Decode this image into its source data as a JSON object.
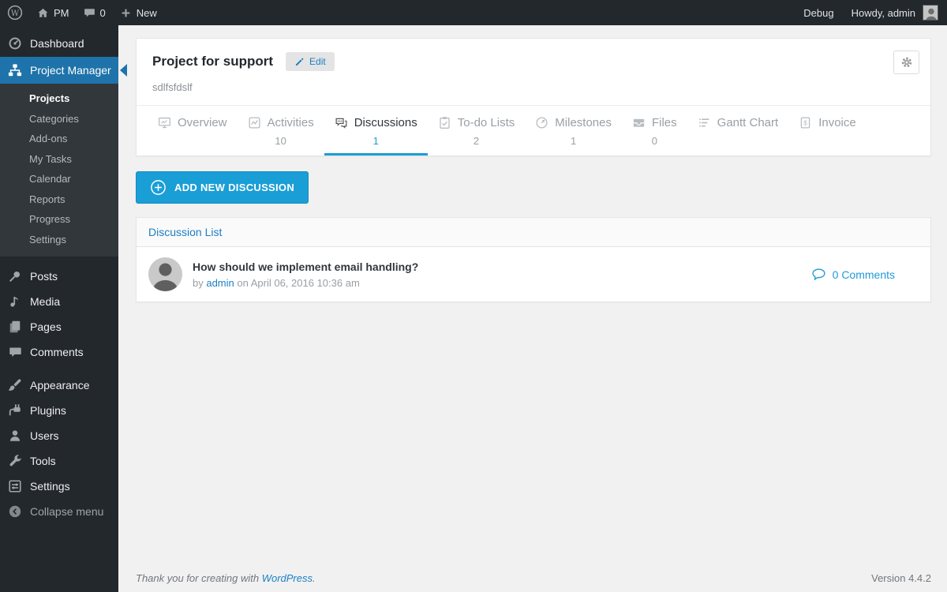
{
  "colors": {
    "menu_active_blue": "#1e73aa",
    "button_blue": "#1a9ed6",
    "link_blue": "#1b7fc4"
  },
  "admin_bar": {
    "site_name": "PM",
    "comment_count": "0",
    "new_label": "New",
    "debug_label": "Debug",
    "howdy": "Howdy, admin"
  },
  "sidebar": {
    "dashboard": "Dashboard",
    "project_manager": "Project Manager",
    "submenu": [
      "Projects",
      "Categories",
      "Add-ons",
      "My Tasks",
      "Calendar",
      "Reports",
      "Progress",
      "Settings"
    ],
    "content_menu": [
      "Posts",
      "Media",
      "Pages",
      "Comments"
    ],
    "admin_menu": [
      "Appearance",
      "Plugins",
      "Users",
      "Tools",
      "Settings"
    ],
    "collapse_label": "Collapse menu"
  },
  "project": {
    "title": "Project for support",
    "edit_label": "Edit",
    "description": "sdlfsfdslf"
  },
  "tabs": [
    {
      "label": "Overview",
      "count": ""
    },
    {
      "label": "Activities",
      "count": "10"
    },
    {
      "label": "Discussions",
      "count": "1"
    },
    {
      "label": "To-do Lists",
      "count": "2"
    },
    {
      "label": "Milestones",
      "count": "1"
    },
    {
      "label": "Files",
      "count": "0"
    },
    {
      "label": "Gantt Chart",
      "count": ""
    },
    {
      "label": "Invoice",
      "count": ""
    }
  ],
  "discussions": {
    "add_button_label": "ADD NEW DISCUSSION",
    "panel_title": "Discussion List",
    "items": [
      {
        "title": "How should we implement email handling?",
        "by_label": "by ",
        "author": "admin",
        "date_text": " on April 06, 2016 10:36 am",
        "comments_label": "0 Comments"
      }
    ]
  },
  "footer": {
    "thanks_prefix": "Thank you for creating with ",
    "wordpress_link": "WordPress",
    "suffix": ".",
    "version": "Version 4.4.2"
  }
}
